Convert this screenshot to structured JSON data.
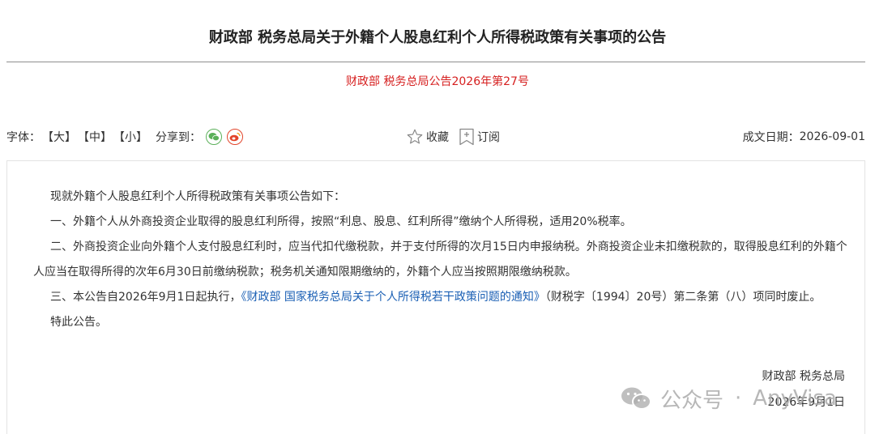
{
  "document": {
    "title": "财政部 税务总局关于外籍个人股息红利个人所得税政策有关事项的公告",
    "doc_number": "财政部 税务总局公告2026年第27号"
  },
  "toolbar": {
    "font_label": "字体：",
    "sizes": [
      "【大】",
      "【中】",
      "【小】"
    ],
    "share_label": "分享到：",
    "favorite_label": "收藏",
    "subscribe_label": "订阅",
    "date_label": "成文日期：",
    "date_value": "2026-09-01"
  },
  "body": {
    "intro": "现就外籍个人股息红利个人所得税政策有关事项公告如下：",
    "item1": "一、外籍个人从外商投资企业取得的股息红利所得，按照“利息、股息、红利所得”缴纳个人所得税，适用20%税率。",
    "item2": "二、外商投资企业向外籍个人支付股息红利时，应当代扣代缴税款，并于支付所得的次月15日内申报纳税。外商投资企业未扣缴税款的，取得股息红利的外籍个人应当在取得所得的次年6月30日前缴纳税款；税务机关通知限期缴纳的，外籍个人应当按照期限缴纳税款。",
    "item3_pre": "三、本公告自2026年9月1日起执行，",
    "item3_link": "《财政部 国家税务总局关于个人所得税若干政策问题的通知》",
    "item3_post": "（财税字〔1994〕20号）第二条第（八）项同时废止。",
    "closing": "特此公告。"
  },
  "signature": {
    "issuer": "财政部 税务总局",
    "date": "2026年9月1日"
  },
  "watermark": {
    "platform": "公众号",
    "separator": "·",
    "account": "AnyVisa"
  },
  "colors": {
    "doc_number": "#d61f1f",
    "link": "#1a5fb4",
    "wechat": "#5bb05a",
    "weibo": "#e2452b"
  },
  "icons": [
    "wechat-icon",
    "weibo-icon",
    "star-icon",
    "subscribe-icon",
    "wechat-watermark-icon"
  ]
}
